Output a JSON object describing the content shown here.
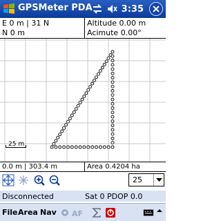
{
  "titlebar": {
    "app_title": "GPSMeter PDA",
    "time": "3:35"
  },
  "info": {
    "easting": "E 0 m | 31 N",
    "northing": "N 0 m",
    "altitude": "Altitude 0.00 m",
    "azimuth": "Acimute 0.00°"
  },
  "map": {
    "scale_label": "25 m"
  },
  "status_row": {
    "distance": "0.0 m | 303.4 m",
    "area": "Area 0.4204 ha"
  },
  "toolbar": {
    "zoom_value": "25"
  },
  "gps_status": {
    "connection": "Disconnected",
    "satellites": "Sat 0 PDOP 0.0"
  },
  "menubar": {
    "file": "File",
    "area": "Area",
    "nav": "Nav"
  },
  "colors": {
    "titlebar": "#0b3a9a",
    "track_point": "#ffffff",
    "grid": "#c8c8c8",
    "stop_icon": "#d40000"
  }
}
